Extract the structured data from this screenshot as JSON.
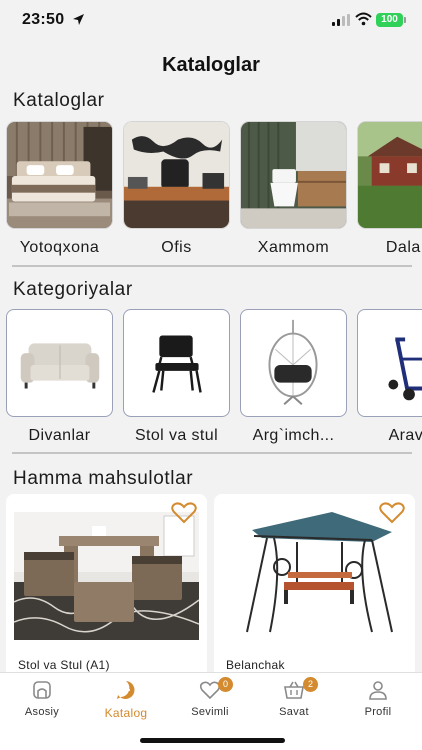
{
  "status": {
    "time": "23:50",
    "battery": "100"
  },
  "page_title": "Kataloglar",
  "catalogs": {
    "title": "Kataloglar",
    "items": [
      {
        "label": "Yotoqxona"
      },
      {
        "label": "Ofis"
      },
      {
        "label": "Xammom"
      },
      {
        "label": "Dala h"
      }
    ]
  },
  "categories": {
    "title": "Kategoriyalar",
    "items": [
      {
        "label": "Divanlar"
      },
      {
        "label": "Stol va stul"
      },
      {
        "label": "Arg`imch..."
      },
      {
        "label": "Arava"
      }
    ]
  },
  "products": {
    "title": "Hamma mahsulotlar",
    "items": [
      {
        "name": "Stol va Stul (A1)"
      },
      {
        "name": "Belanchak"
      }
    ]
  },
  "tabbar": {
    "items": [
      {
        "label": "Asosiy",
        "icon": "home-icon"
      },
      {
        "label": "Katalog",
        "icon": "catalog-icon",
        "active": true
      },
      {
        "label": "Sevimli",
        "icon": "heart-icon",
        "badge": "0"
      },
      {
        "label": "Savat",
        "icon": "basket-icon",
        "badge": "2"
      },
      {
        "label": "Profil",
        "icon": "profile-icon"
      }
    ]
  },
  "colors": {
    "accent": "#d48a2e",
    "background": "#f2f2f2",
    "battery": "#2fd158"
  }
}
